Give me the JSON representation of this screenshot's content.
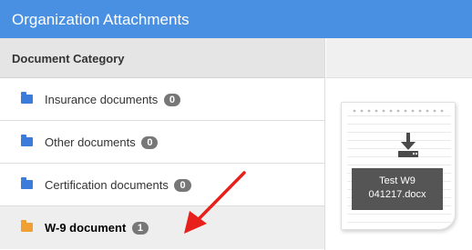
{
  "header": {
    "title": "Organization Attachments"
  },
  "categories": {
    "header": "Document Category",
    "items": [
      {
        "label": "Insurance documents",
        "count": "0",
        "active": false
      },
      {
        "label": "Other documents",
        "count": "0",
        "active": false
      },
      {
        "label": "Certification documents",
        "count": "0",
        "active": false
      },
      {
        "label": "W-9 document",
        "count": "1",
        "active": true
      }
    ]
  },
  "attachment": {
    "name_line1": "Test W9",
    "name_line2": "041217.docx",
    "icon": "download-icon"
  },
  "colors": {
    "header_bg": "#4a90e2",
    "folder": "#3b7bd9",
    "folder_open": "#f0a033",
    "badge": "#777777",
    "arrow": "#e8201b"
  }
}
